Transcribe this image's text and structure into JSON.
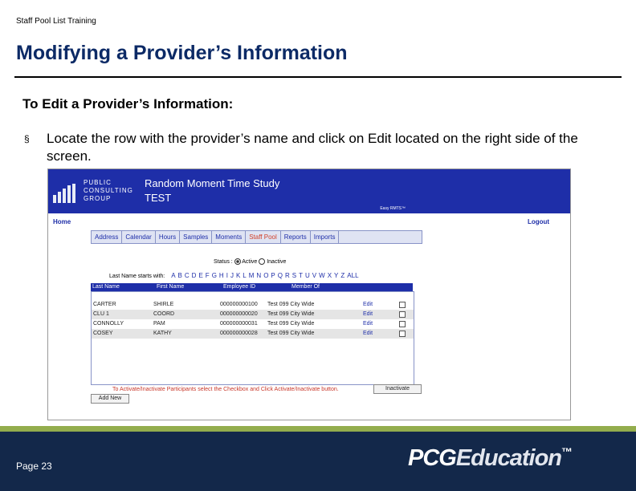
{
  "header": {
    "top_note": "Staff Pool List Training",
    "title": "Modifying a Provider’s Information"
  },
  "content": {
    "subheading": "To Edit a Provider’s Information:",
    "bullet_mark": "§",
    "bullet_text": "Locate the row with the provider’s name and click on Edit located on the right side of the screen."
  },
  "screenshot": {
    "logo_text": [
      "PUBLIC",
      "CONSULTING",
      "GROUP"
    ],
    "app_title": "Random Moment Time Study",
    "app_subtitle": "TEST",
    "powered_by": "Easy RMTS™",
    "home_label": "Home",
    "logout_label": "Logout",
    "menu": [
      "Address",
      "Calendar",
      "Hours",
      "Samples",
      "Moments",
      "Staff Pool",
      "Reports",
      "Imports"
    ],
    "active_menu": "Staff Pool",
    "status_label": "Status :",
    "status_active": "Active",
    "status_inactive": "Inactive",
    "last_name_label": "Last Name starts with:",
    "letters": [
      "A",
      "B",
      "C",
      "D",
      "E",
      "F",
      "G",
      "H",
      "I",
      "J",
      "K",
      "L",
      "M",
      "N",
      "O",
      "P",
      "Q",
      "R",
      "S",
      "T",
      "U",
      "V",
      "W",
      "X",
      "Y",
      "Z",
      "ALL"
    ],
    "columns": [
      "Last Name",
      "First Name",
      "Employee ID",
      "Member Of"
    ],
    "rows": [
      {
        "last": "CARTER",
        "first": "SHIRLE",
        "id": "000000000100",
        "member": "Test 099 City Wide",
        "action": "Edit"
      },
      {
        "last": "CLU 1",
        "first": "COORD",
        "id": "000000000020",
        "member": "Test 099 City Wide",
        "action": "Edit"
      },
      {
        "last": "CONNOLLY",
        "first": "PAM",
        "id": "000000000031",
        "member": "Test 099 City Wide",
        "action": "Edit"
      },
      {
        "last": "COSEY",
        "first": "KATHY",
        "id": "000000000028",
        "member": "Test 099 City Wide",
        "action": "Edit"
      }
    ],
    "instruction": "To Activate/Inactivate Participants select the Checkbox and Click Activate/Inactivate button.",
    "inactivate_button": "Inactivate",
    "add_new_button": "Add New"
  },
  "footer": {
    "page_label": "Page 23",
    "brand_pcg": "PCG",
    "brand_edu": "Education",
    "brand_tm": "™"
  },
  "colors": {
    "title": "#0c2a66",
    "app_header": "#1e2ea8",
    "footer": "#13284a",
    "footer_accent": "#93ad4d",
    "note_red": "#c8372a"
  }
}
